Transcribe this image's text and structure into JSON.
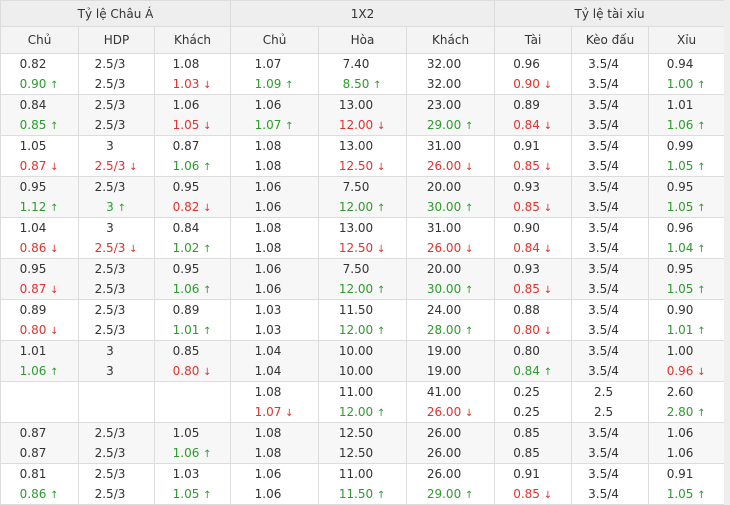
{
  "groups": [
    {
      "label": "Tỷ lệ Châu Á",
      "span": 3
    },
    {
      "label": "1X2",
      "span": 3
    },
    {
      "label": "Tỷ lệ tài xỉu",
      "span": 3
    }
  ],
  "columns": [
    "Chủ",
    "HDP",
    "Khách",
    "Chủ",
    "Hòa",
    "Khách",
    "Tài",
    "Kèo đấu",
    "Xỉu"
  ],
  "rows": [
    {
      "cells": [
        {
          "top": {
            "t": "0.82"
          },
          "bot": {
            "t": "0.90",
            "d": "up"
          }
        },
        {
          "top": {
            "t": "2.5/3"
          },
          "bot": {
            "t": "2.5/3"
          }
        },
        {
          "top": {
            "t": "1.08"
          },
          "bot": {
            "t": "1.03",
            "d": "down"
          }
        },
        {
          "top": {
            "t": "1.07"
          },
          "bot": {
            "t": "1.09",
            "d": "up"
          }
        },
        {
          "top": {
            "t": "7.40"
          },
          "bot": {
            "t": "8.50",
            "d": "up"
          }
        },
        {
          "top": {
            "t": "32.00"
          },
          "bot": {
            "t": "32.00"
          }
        },
        {
          "top": {
            "t": "0.96"
          },
          "bot": {
            "t": "0.90",
            "d": "down"
          }
        },
        {
          "top": {
            "t": "3.5/4"
          },
          "bot": {
            "t": "3.5/4"
          }
        },
        {
          "top": {
            "t": "0.94"
          },
          "bot": {
            "t": "1.00",
            "d": "up"
          }
        }
      ]
    },
    {
      "cells": [
        {
          "top": {
            "t": "0.84"
          },
          "bot": {
            "t": "0.85",
            "d": "up"
          }
        },
        {
          "top": {
            "t": "2.5/3"
          },
          "bot": {
            "t": "2.5/3"
          }
        },
        {
          "top": {
            "t": "1.06"
          },
          "bot": {
            "t": "1.05",
            "d": "down"
          }
        },
        {
          "top": {
            "t": "1.06"
          },
          "bot": {
            "t": "1.07",
            "d": "up"
          }
        },
        {
          "top": {
            "t": "13.00"
          },
          "bot": {
            "t": "12.00",
            "d": "down"
          }
        },
        {
          "top": {
            "t": "23.00"
          },
          "bot": {
            "t": "29.00",
            "d": "up"
          }
        },
        {
          "top": {
            "t": "0.89"
          },
          "bot": {
            "t": "0.84",
            "d": "down"
          }
        },
        {
          "top": {
            "t": "3.5/4"
          },
          "bot": {
            "t": "3.5/4"
          }
        },
        {
          "top": {
            "t": "1.01"
          },
          "bot": {
            "t": "1.06",
            "d": "up"
          }
        }
      ]
    },
    {
      "cells": [
        {
          "top": {
            "t": "1.05"
          },
          "bot": {
            "t": "0.87",
            "d": "down"
          }
        },
        {
          "top": {
            "t": "3"
          },
          "bot": {
            "t": "2.5/3",
            "d": "down"
          }
        },
        {
          "top": {
            "t": "0.87"
          },
          "bot": {
            "t": "1.06",
            "d": "up"
          }
        },
        {
          "top": {
            "t": "1.08"
          },
          "bot": {
            "t": "1.08"
          }
        },
        {
          "top": {
            "t": "13.00"
          },
          "bot": {
            "t": "12.50",
            "d": "down"
          }
        },
        {
          "top": {
            "t": "31.00"
          },
          "bot": {
            "t": "26.00",
            "d": "down"
          }
        },
        {
          "top": {
            "t": "0.91"
          },
          "bot": {
            "t": "0.85",
            "d": "down"
          }
        },
        {
          "top": {
            "t": "3.5/4"
          },
          "bot": {
            "t": "3.5/4"
          }
        },
        {
          "top": {
            "t": "0.99"
          },
          "bot": {
            "t": "1.05",
            "d": "up"
          }
        }
      ]
    },
    {
      "cells": [
        {
          "top": {
            "t": "0.95"
          },
          "bot": {
            "t": "1.12",
            "d": "up"
          }
        },
        {
          "top": {
            "t": "2.5/3"
          },
          "bot": {
            "t": "3",
            "d": "up"
          }
        },
        {
          "top": {
            "t": "0.95"
          },
          "bot": {
            "t": "0.82",
            "d": "down"
          }
        },
        {
          "top": {
            "t": "1.06"
          },
          "bot": {
            "t": "1.06"
          }
        },
        {
          "top": {
            "t": "7.50"
          },
          "bot": {
            "t": "12.00",
            "d": "up"
          }
        },
        {
          "top": {
            "t": "20.00"
          },
          "bot": {
            "t": "30.00",
            "d": "up"
          }
        },
        {
          "top": {
            "t": "0.93"
          },
          "bot": {
            "t": "0.85",
            "d": "down"
          }
        },
        {
          "top": {
            "t": "3.5/4"
          },
          "bot": {
            "t": "3.5/4"
          }
        },
        {
          "top": {
            "t": "0.95"
          },
          "bot": {
            "t": "1.05",
            "d": "up"
          }
        }
      ]
    },
    {
      "cells": [
        {
          "top": {
            "t": "1.04"
          },
          "bot": {
            "t": "0.86",
            "d": "down"
          }
        },
        {
          "top": {
            "t": "3"
          },
          "bot": {
            "t": "2.5/3",
            "d": "down"
          }
        },
        {
          "top": {
            "t": "0.84"
          },
          "bot": {
            "t": "1.02",
            "d": "up"
          }
        },
        {
          "top": {
            "t": "1.08"
          },
          "bot": {
            "t": "1.08"
          }
        },
        {
          "top": {
            "t": "13.00"
          },
          "bot": {
            "t": "12.50",
            "d": "down"
          }
        },
        {
          "top": {
            "t": "31.00"
          },
          "bot": {
            "t": "26.00",
            "d": "down"
          }
        },
        {
          "top": {
            "t": "0.90"
          },
          "bot": {
            "t": "0.84",
            "d": "down"
          }
        },
        {
          "top": {
            "t": "3.5/4"
          },
          "bot": {
            "t": "3.5/4"
          }
        },
        {
          "top": {
            "t": "0.96"
          },
          "bot": {
            "t": "1.04",
            "d": "up"
          }
        }
      ]
    },
    {
      "cells": [
        {
          "top": {
            "t": "0.95"
          },
          "bot": {
            "t": "0.87",
            "d": "down"
          }
        },
        {
          "top": {
            "t": "2.5/3"
          },
          "bot": {
            "t": "2.5/3"
          }
        },
        {
          "top": {
            "t": "0.95"
          },
          "bot": {
            "t": "1.06",
            "d": "up"
          }
        },
        {
          "top": {
            "t": "1.06"
          },
          "bot": {
            "t": "1.06"
          }
        },
        {
          "top": {
            "t": "7.50"
          },
          "bot": {
            "t": "12.00",
            "d": "up"
          }
        },
        {
          "top": {
            "t": "20.00"
          },
          "bot": {
            "t": "30.00",
            "d": "up"
          }
        },
        {
          "top": {
            "t": "0.93"
          },
          "bot": {
            "t": "0.85",
            "d": "down"
          }
        },
        {
          "top": {
            "t": "3.5/4"
          },
          "bot": {
            "t": "3.5/4"
          }
        },
        {
          "top": {
            "t": "0.95"
          },
          "bot": {
            "t": "1.05",
            "d": "up"
          }
        }
      ]
    },
    {
      "cells": [
        {
          "top": {
            "t": "0.89"
          },
          "bot": {
            "t": "0.80",
            "d": "down"
          }
        },
        {
          "top": {
            "t": "2.5/3"
          },
          "bot": {
            "t": "2.5/3"
          }
        },
        {
          "top": {
            "t": "0.89"
          },
          "bot": {
            "t": "1.01",
            "d": "up"
          }
        },
        {
          "top": {
            "t": "1.03"
          },
          "bot": {
            "t": "1.03"
          }
        },
        {
          "top": {
            "t": "11.50"
          },
          "bot": {
            "t": "12.00",
            "d": "up"
          }
        },
        {
          "top": {
            "t": "24.00"
          },
          "bot": {
            "t": "28.00",
            "d": "up"
          }
        },
        {
          "top": {
            "t": "0.88"
          },
          "bot": {
            "t": "0.80",
            "d": "down"
          }
        },
        {
          "top": {
            "t": "3.5/4"
          },
          "bot": {
            "t": "3.5/4"
          }
        },
        {
          "top": {
            "t": "0.90"
          },
          "bot": {
            "t": "1.01",
            "d": "up"
          }
        }
      ]
    },
    {
      "cells": [
        {
          "top": {
            "t": "1.01"
          },
          "bot": {
            "t": "1.06",
            "d": "up"
          }
        },
        {
          "top": {
            "t": "3"
          },
          "bot": {
            "t": "3"
          }
        },
        {
          "top": {
            "t": "0.85"
          },
          "bot": {
            "t": "0.80",
            "d": "down"
          }
        },
        {
          "top": {
            "t": "1.04"
          },
          "bot": {
            "t": "1.04"
          }
        },
        {
          "top": {
            "t": "10.00"
          },
          "bot": {
            "t": "10.00"
          }
        },
        {
          "top": {
            "t": "19.00"
          },
          "bot": {
            "t": "19.00"
          }
        },
        {
          "top": {
            "t": "0.80"
          },
          "bot": {
            "t": "0.84",
            "d": "up"
          }
        },
        {
          "top": {
            "t": "3.5/4"
          },
          "bot": {
            "t": "3.5/4"
          }
        },
        {
          "top": {
            "t": "1.00"
          },
          "bot": {
            "t": "0.96",
            "d": "down"
          }
        }
      ]
    },
    {
      "cells": [
        {
          "top": {
            "t": ""
          },
          "bot": {
            "t": ""
          }
        },
        {
          "top": {
            "t": ""
          },
          "bot": {
            "t": ""
          }
        },
        {
          "top": {
            "t": ""
          },
          "bot": {
            "t": ""
          }
        },
        {
          "top": {
            "t": "1.08"
          },
          "bot": {
            "t": "1.07",
            "d": "down"
          }
        },
        {
          "top": {
            "t": "11.00"
          },
          "bot": {
            "t": "12.00",
            "d": "up"
          }
        },
        {
          "top": {
            "t": "41.00"
          },
          "bot": {
            "t": "26.00",
            "d": "down"
          }
        },
        {
          "top": {
            "t": "0.25"
          },
          "bot": {
            "t": "0.25"
          }
        },
        {
          "top": {
            "t": "2.5"
          },
          "bot": {
            "t": "2.5"
          }
        },
        {
          "top": {
            "t": "2.60"
          },
          "bot": {
            "t": "2.80",
            "d": "up"
          }
        }
      ]
    },
    {
      "cells": [
        {
          "top": {
            "t": "0.87"
          },
          "bot": {
            "t": "0.87"
          }
        },
        {
          "top": {
            "t": "2.5/3"
          },
          "bot": {
            "t": "2.5/3"
          }
        },
        {
          "top": {
            "t": "1.05"
          },
          "bot": {
            "t": "1.06",
            "d": "up"
          }
        },
        {
          "top": {
            "t": "1.08"
          },
          "bot": {
            "t": "1.08"
          }
        },
        {
          "top": {
            "t": "12.50"
          },
          "bot": {
            "t": "12.50"
          }
        },
        {
          "top": {
            "t": "26.00"
          },
          "bot": {
            "t": "26.00"
          }
        },
        {
          "top": {
            "t": "0.85"
          },
          "bot": {
            "t": "0.85"
          }
        },
        {
          "top": {
            "t": "3.5/4"
          },
          "bot": {
            "t": "3.5/4"
          }
        },
        {
          "top": {
            "t": "1.06"
          },
          "bot": {
            "t": "1.06"
          }
        }
      ]
    },
    {
      "cells": [
        {
          "top": {
            "t": "0.81"
          },
          "bot": {
            "t": "0.86",
            "d": "up"
          }
        },
        {
          "top": {
            "t": "2.5/3"
          },
          "bot": {
            "t": "2.5/3"
          }
        },
        {
          "top": {
            "t": "1.03"
          },
          "bot": {
            "t": "1.05",
            "d": "up"
          }
        },
        {
          "top": {
            "t": "1.06"
          },
          "bot": {
            "t": "1.06"
          }
        },
        {
          "top": {
            "t": "11.00"
          },
          "bot": {
            "t": "11.50",
            "d": "up"
          }
        },
        {
          "top": {
            "t": "26.00"
          },
          "bot": {
            "t": "29.00",
            "d": "up"
          }
        },
        {
          "top": {
            "t": "0.91"
          },
          "bot": {
            "t": "0.85",
            "d": "down"
          }
        },
        {
          "top": {
            "t": "3.5/4"
          },
          "bot": {
            "t": "3.5/4"
          }
        },
        {
          "top": {
            "t": "0.91"
          },
          "bot": {
            "t": "1.05",
            "d": "up"
          }
        }
      ]
    }
  ],
  "icons": {
    "up": "arrow-up-icon",
    "down": "arrow-down-icon"
  },
  "colors": {
    "up": "#2e9a2e",
    "down": "#e0322d",
    "header_bg": "#eeeeee",
    "alt_row_bg": "#f7f7f7",
    "border": "#dcdcdc"
  }
}
